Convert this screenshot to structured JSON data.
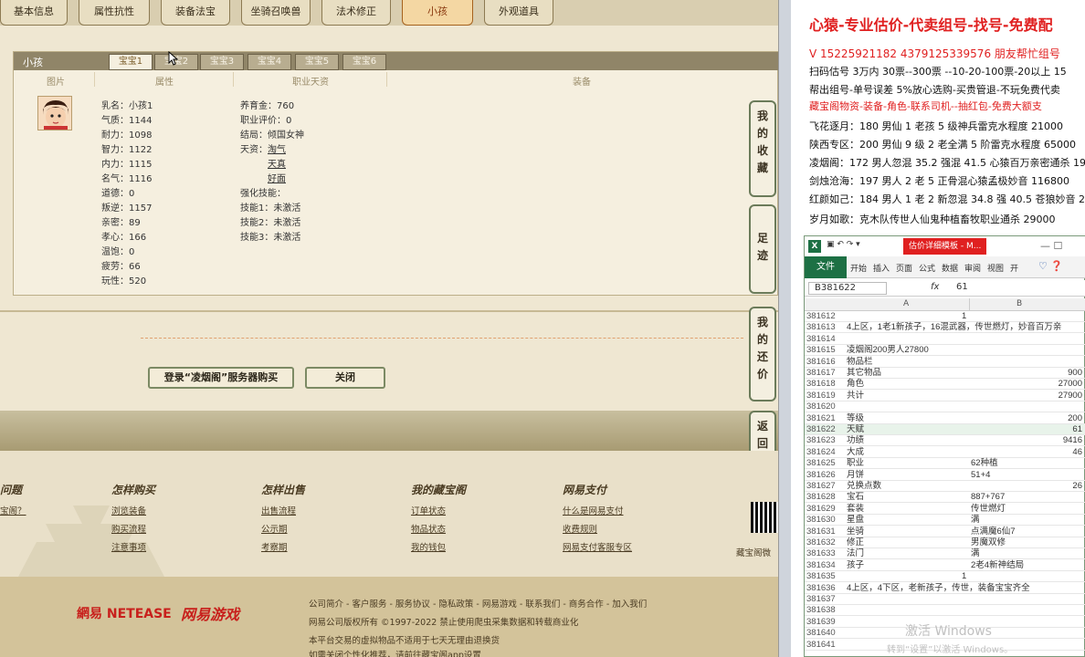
{
  "tabs": [
    "基本信息",
    "属性抗性",
    "装备法宝",
    "坐骑召唤兽",
    "法术修正",
    "小孩",
    "外观道具"
  ],
  "active_tab": "小孩",
  "panel": {
    "title": "小孩",
    "subtabs": [
      "宝宝1",
      "宝宝2",
      "宝宝3",
      "宝宝4",
      "宝宝5",
      "宝宝6"
    ],
    "columns": [
      "图片",
      "属性",
      "职业天资",
      "装备"
    ]
  },
  "child_stats_left": [
    {
      "k": "乳名：",
      "v": "小孩1"
    },
    {
      "k": "气质：",
      "v": "1144"
    },
    {
      "k": "耐力：",
      "v": "1098"
    },
    {
      "k": "智力：",
      "v": "1122"
    },
    {
      "k": "内力：",
      "v": "1115"
    },
    {
      "k": "名气：",
      "v": "1116"
    },
    {
      "k": "道德：",
      "v": "0"
    },
    {
      "k": "叛逆：",
      "v": "1157"
    },
    {
      "k": "亲密：",
      "v": "89"
    },
    {
      "k": "孝心：",
      "v": "166"
    },
    {
      "k": "温饱：",
      "v": "0"
    },
    {
      "k": "疲劳：",
      "v": "66"
    },
    {
      "k": "玩性：",
      "v": "520"
    }
  ],
  "child_stats_right": [
    {
      "k": "养育金：",
      "v": "760"
    },
    {
      "k": "职业评价：",
      "v": "0"
    },
    {
      "k": "结局：",
      "v": "倾国女神"
    },
    {
      "k": "天资：",
      "v": "淘气"
    },
    {
      "k": "",
      "v": "天真"
    },
    {
      "k": "",
      "v": "好面"
    },
    {
      "k": "强化技能：",
      "v": ""
    },
    {
      "k": "技能1：",
      "v": "未激活"
    },
    {
      "k": "技能2：",
      "v": "未激活"
    },
    {
      "k": "技能3：",
      "v": "未激活"
    }
  ],
  "side_buttons": [
    "我的收藏",
    "足迹",
    "我的还价",
    "返回顶部"
  ],
  "buttons": {
    "buy": "登录“凌烟阁”服务器购买",
    "close": "关闭"
  },
  "footer": {
    "col0_head": "问题",
    "col0_link": "宝阁？",
    "col1_head": "怎样购买",
    "col1_links": [
      "浏览装备",
      "购买流程",
      "注意事项"
    ],
    "col2_head": "怎样出售",
    "col2_links": [
      "出售流程",
      "公示期",
      "考察期"
    ],
    "col3_head": "我的藏宝阁",
    "col3_links": [
      "订单状态",
      "物品状态",
      "我的钱包"
    ],
    "col4_head": "网易支付",
    "col4_links": [
      "什么是网易支付",
      "收费规则",
      "网易支付客服专区"
    ],
    "cbg_label": "藏宝阁微",
    "brand1": "網易 NETEASE",
    "brand2": "网易游戏",
    "links_line": "公司简介 - 客户服务 - 服务协议 - 隐私政策 - 网易游戏 - 联系我们 - 商务合作 - 加入我们",
    "copyright": "网易公司版权所有 ©1997-2022 禁止使用爬虫采集数据和转载商业化",
    "notice1": "本平台交易的虚拟物品不适用于七天无理由退换货",
    "notice2": "如需关闭个性化推荐，请前往藏宝阁app设置"
  },
  "ad": {
    "title": "心猿-专业估价-代卖组号-找号-免费配",
    "phone": "V 15225921182  4379125339576 朋友帮忙组号",
    "lines": [
      "扫码估号 3万内 30票--300票 --10-20-100票-20以上 15",
      "帮出组号-单号误差 5%放心选购-买贵管退-不玩免费代卖",
      "藏宝阁物资-装备-角色-联系司机--抽红包-免费大额支",
      "飞花逐月：180 男仙 1 老孩 5 级神兵雷克水程度 21000",
      "陕西专区：200 男仙 9 级 2 老全满 5 阶雷克水程度 65000",
      "凌烟阁：172 男人忽混 35.2 强混 41.5 心猿百万亲密通杀 193",
      "剑烛沧海：197 男人 2 老 5 正骨混心猿孟极妙音 116800",
      "红颜如己：184 男人 1 老 2 新忽混 34.8 强 40.5 苍狼妙音 229",
      "岁月如歌：克木队传世人仙鬼种植畜牧职业通杀 29000"
    ]
  },
  "excel": {
    "title": "估价详细模板 - M...",
    "ribbon_file": "文件",
    "ribbon_tabs": [
      "开始",
      "插入",
      "页面",
      "公式",
      "数据",
      "审阅",
      "视图",
      "开"
    ],
    "namebox": "B381622",
    "formula": "61",
    "col_a": "A",
    "col_b": "B",
    "rows": [
      {
        "n": "381612",
        "a": "",
        "b": "",
        "an": "1"
      },
      {
        "n": "381613",
        "a": "4上区，1老1新孩子，16混武器，传世燃灯，妙音百万亲",
        "b": "",
        "an": ""
      },
      {
        "n": "381614",
        "a": "",
        "b": "",
        "an": ""
      },
      {
        "n": "381615",
        "a": "凌烟阁200男人27800",
        "b": "",
        "an": ""
      },
      {
        "n": "381616",
        "a": "物品栏",
        "b": "",
        "an": ""
      },
      {
        "n": "381617",
        "a": "其它物品",
        "b": "900",
        "an": ""
      },
      {
        "n": "381618",
        "a": "角色",
        "b": "27000",
        "an": ""
      },
      {
        "n": "381619",
        "a": "共计",
        "b": "27900",
        "an": ""
      },
      {
        "n": "381620",
        "a": "",
        "b": "",
        "an": ""
      },
      {
        "n": "381621",
        "a": "等级",
        "b": "200",
        "an": ""
      },
      {
        "n": "381622",
        "a": "天赋",
        "b": "61",
        "an": ""
      },
      {
        "n": "381623",
        "a": "功绩",
        "b": "9416",
        "an": ""
      },
      {
        "n": "381624",
        "a": "大成",
        "b": "46",
        "an": ""
      },
      {
        "n": "381625",
        "a": "职业",
        "bl": "62种植",
        "an": ""
      },
      {
        "n": "381626",
        "a": "月饼",
        "bl": "51+4",
        "an": ""
      },
      {
        "n": "381627",
        "a": "兑换点数",
        "b": "26",
        "an": ""
      },
      {
        "n": "381628",
        "a": "宝石",
        "bl": "887+767",
        "an": ""
      },
      {
        "n": "381629",
        "a": "套装",
        "bl": "传世燃灯",
        "an": ""
      },
      {
        "n": "381630",
        "a": "星盘",
        "bl": "满",
        "an": ""
      },
      {
        "n": "381631",
        "a": "坐骑",
        "bl": "点满魔6仙7",
        "an": ""
      },
      {
        "n": "381632",
        "a": "修正",
        "bl": "男魔双修",
        "an": ""
      },
      {
        "n": "381633",
        "a": "法门",
        "bl": "满",
        "an": ""
      },
      {
        "n": "381634",
        "a": "孩子",
        "bl": "2老4新神结局",
        "an": ""
      },
      {
        "n": "381635",
        "a": "",
        "b": "",
        "an": "1"
      },
      {
        "n": "381636",
        "a": "4上区，4下区，老新孩子，传世，装备宝宝齐全",
        "b": "",
        "an": ""
      },
      {
        "n": "381637",
        "a": "",
        "b": "",
        "an": ""
      },
      {
        "n": "381638",
        "a": "",
        "b": "",
        "an": ""
      },
      {
        "n": "381639",
        "a": "",
        "b": "",
        "an": ""
      },
      {
        "n": "381640",
        "a": "",
        "b": "",
        "an": ""
      },
      {
        "n": "381641",
        "a": "",
        "b": "",
        "an": ""
      }
    ],
    "watermark1": "激活 Windows",
    "watermark2": "转到“设置”以激活 Windows。"
  }
}
